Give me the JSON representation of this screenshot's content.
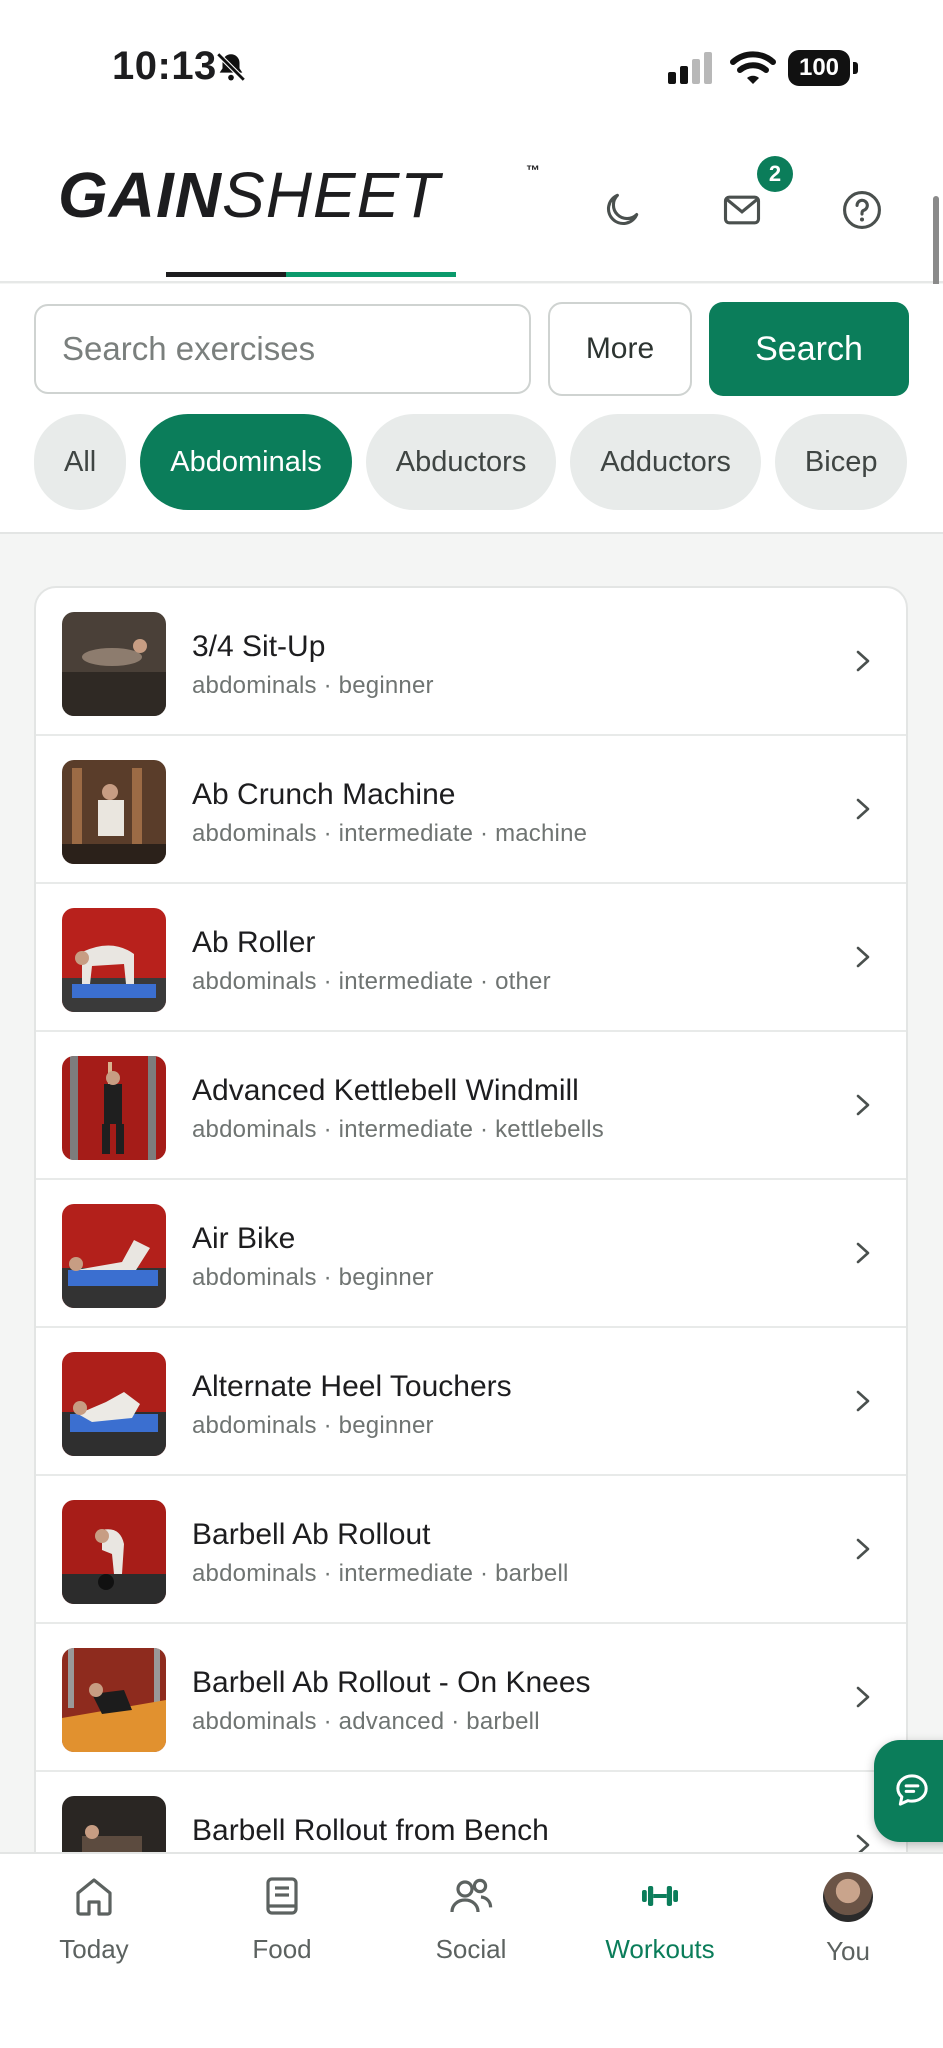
{
  "status_bar": {
    "time": "10:13",
    "battery": "100"
  },
  "header": {
    "logo_bold": "GAIN",
    "logo_light": "SHEET",
    "logo_tm": "™",
    "mail_badge": "2",
    "icons": [
      "moon-icon",
      "mail-icon",
      "help-icon"
    ]
  },
  "search": {
    "placeholder": "Search exercises",
    "value": "",
    "more_label": "More",
    "search_label": "Search"
  },
  "chips": [
    {
      "label": "All",
      "active": false
    },
    {
      "label": "Abdominals",
      "active": true
    },
    {
      "label": "Abductors",
      "active": false
    },
    {
      "label": "Adductors",
      "active": false
    },
    {
      "label": "Bicep",
      "active": false
    }
  ],
  "exercises": [
    {
      "name": "3/4 Sit-Up",
      "meta": "abdominals · beginner"
    },
    {
      "name": "Ab Crunch Machine",
      "meta": "abdominals · intermediate · machine"
    },
    {
      "name": "Ab Roller",
      "meta": "abdominals · intermediate · other"
    },
    {
      "name": "Advanced Kettlebell Windmill",
      "meta": "abdominals · intermediate · kettlebells"
    },
    {
      "name": "Air Bike",
      "meta": "abdominals · beginner"
    },
    {
      "name": "Alternate Heel Touchers",
      "meta": "abdominals · beginner"
    },
    {
      "name": "Barbell Ab Rollout",
      "meta": "abdominals · intermediate · barbell"
    },
    {
      "name": "Barbell Ab Rollout - On Knees",
      "meta": "abdominals · advanced · barbell"
    },
    {
      "name": "Barbell Rollout from Bench",
      "meta": ""
    }
  ],
  "tabbar": {
    "items": [
      {
        "label": "Today",
        "icon": "home-icon",
        "active": false
      },
      {
        "label": "Food",
        "icon": "book-icon",
        "active": false
      },
      {
        "label": "Social",
        "icon": "people-icon",
        "active": false
      },
      {
        "label": "Workouts",
        "icon": "dumbbell-icon",
        "active": true
      },
      {
        "label": "You",
        "icon": "avatar",
        "active": false
      }
    ]
  },
  "colors": {
    "brand": "#0b7d5a",
    "chip_bg": "#e8ebea",
    "text": "#1d1d1f",
    "muted": "#6f7472"
  }
}
